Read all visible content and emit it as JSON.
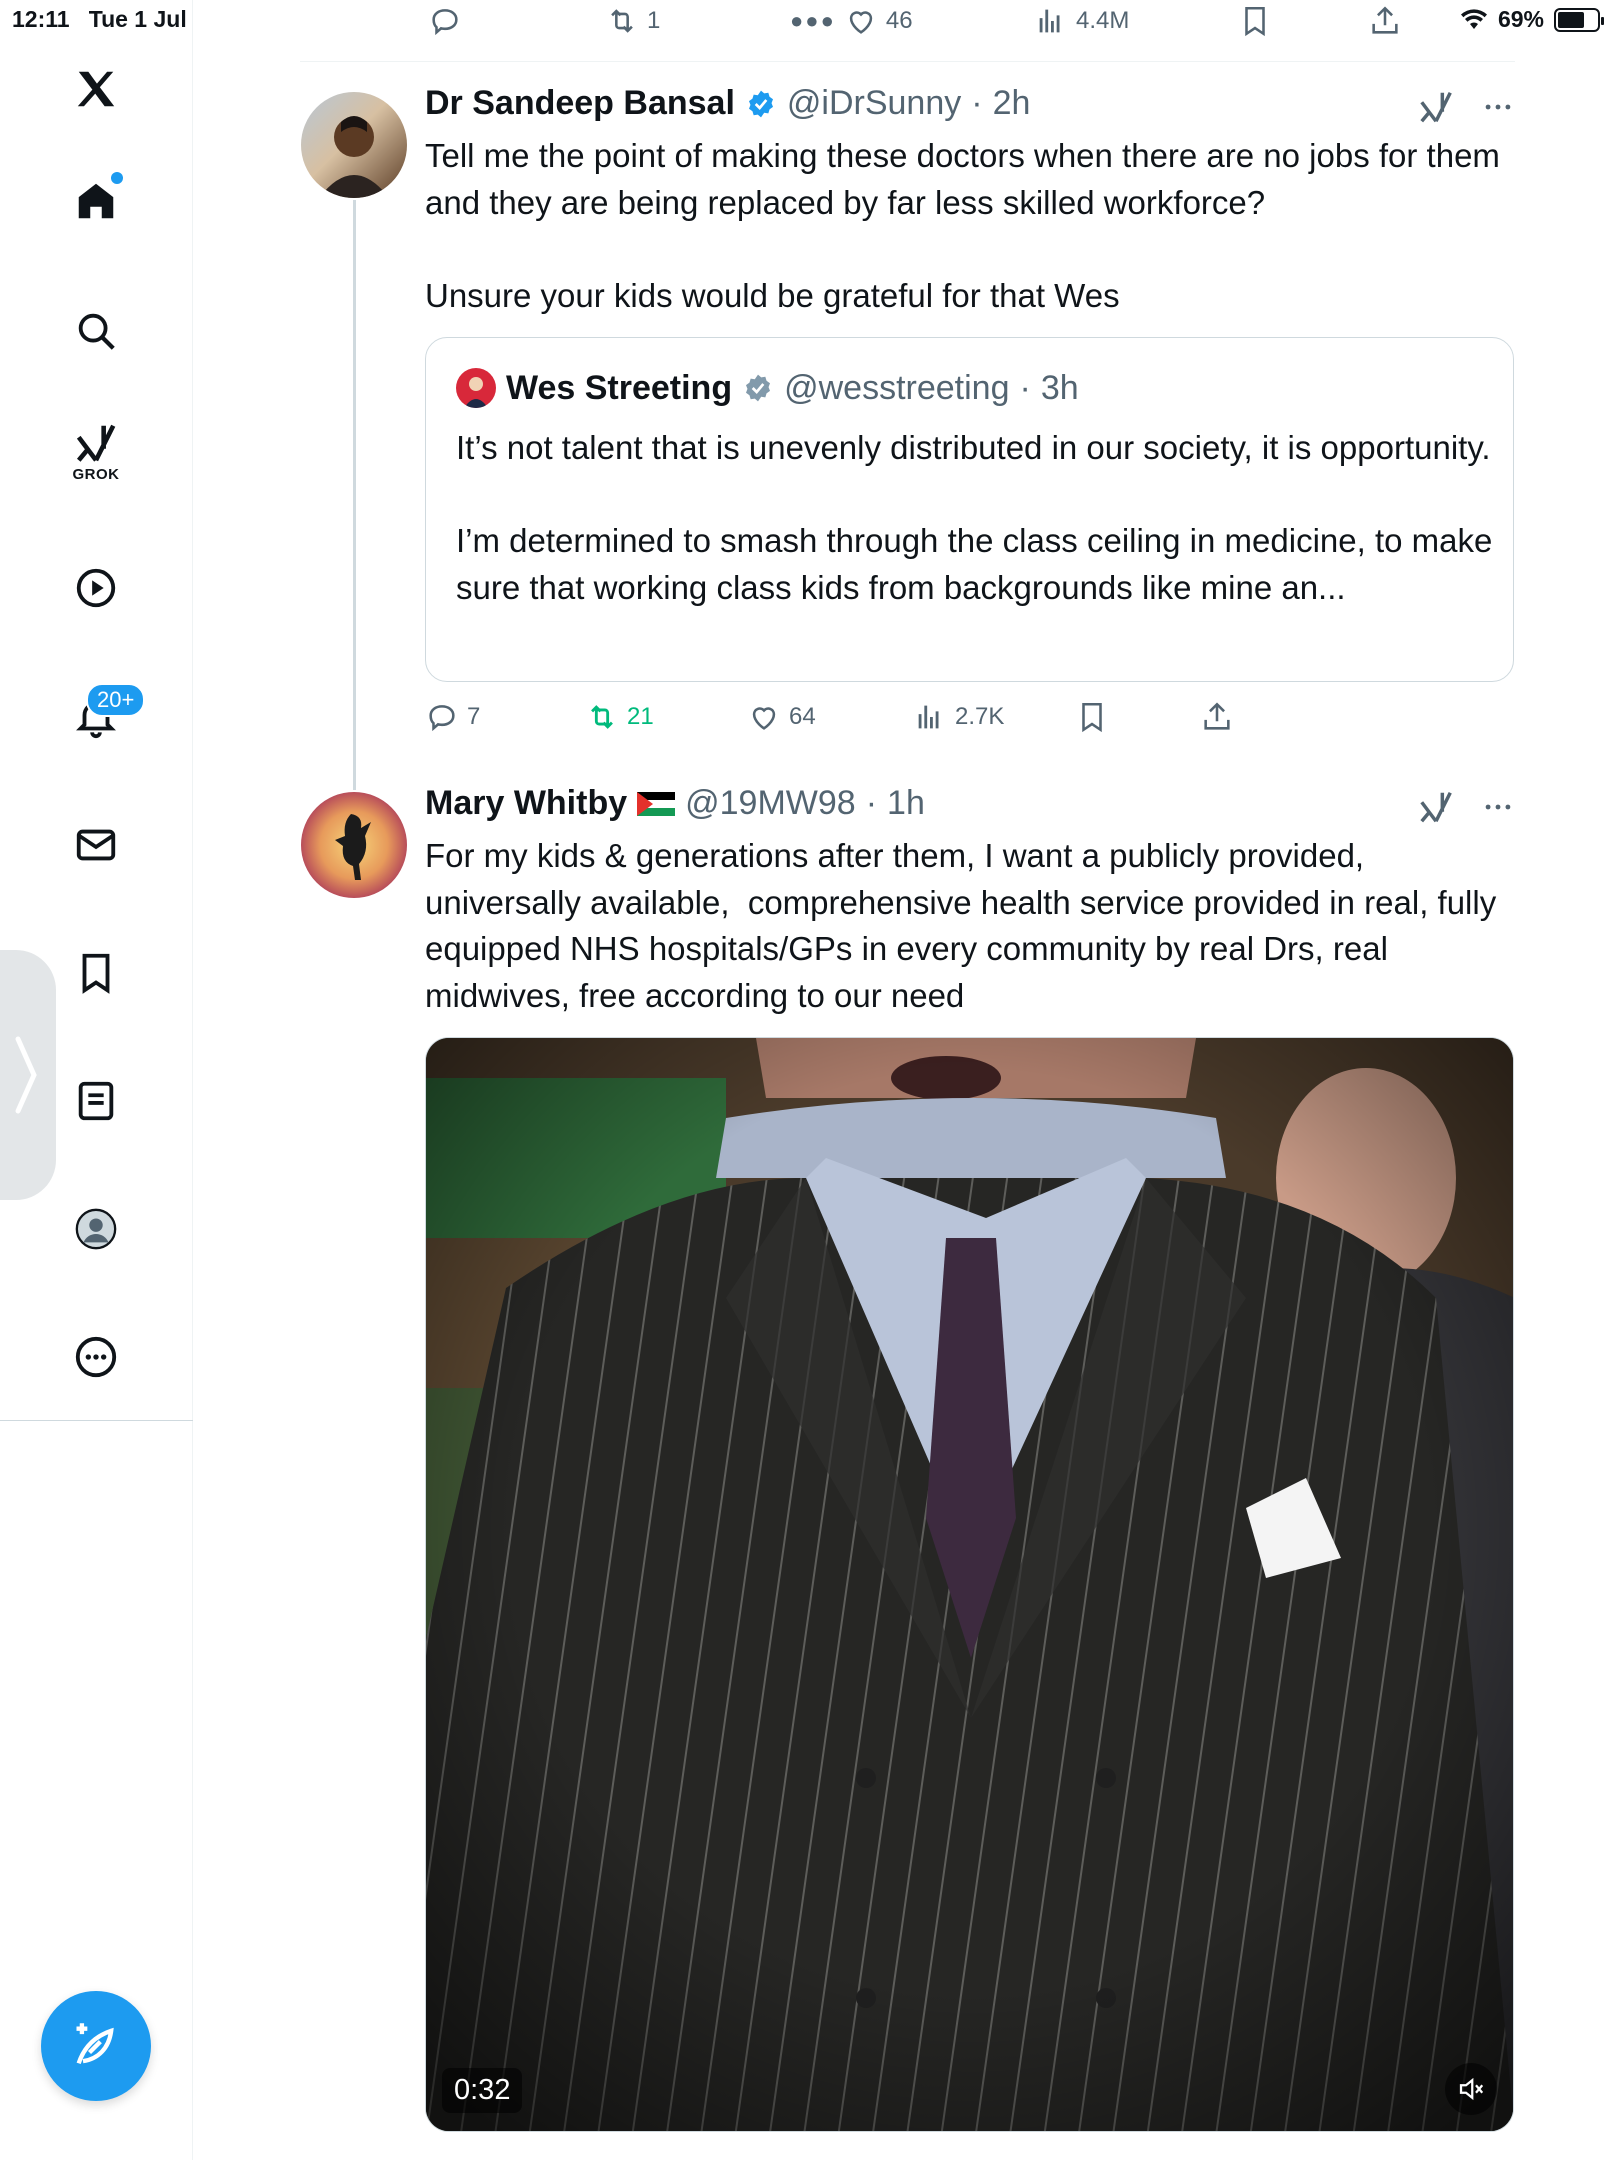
{
  "status_bar": {
    "time": "12:11",
    "date": "Tue 1 Jul",
    "battery": "69%",
    "battery_level": 0.69
  },
  "previous_tweet_actions": {
    "retweets": "1",
    "likes": "46",
    "views": "4.4M"
  },
  "sidebar": {
    "items": [
      {
        "icon": "x-logo-icon"
      },
      {
        "icon": "home-icon"
      },
      {
        "icon": "search-icon"
      },
      {
        "icon": "grok-icon",
        "label": "GROK"
      },
      {
        "icon": "video-icon"
      },
      {
        "icon": "notifications-icon",
        "badge": "20+"
      },
      {
        "icon": "messages-icon"
      },
      {
        "icon": "bookmarks-icon"
      },
      {
        "icon": "lists-icon"
      },
      {
        "icon": "profile-icon"
      },
      {
        "icon": "more-icon"
      }
    ],
    "compose_icon": "compose-icon"
  },
  "tweets": [
    {
      "name": "Dr Sandeep Bansal",
      "verified": true,
      "handle": "@iDrSunny",
      "separator": "·",
      "time": "2h",
      "text": "Tell me the point of making these doctors when there are no jobs for them and they are being replaced by far less skilled workforce?\n\nUnsure your kids would be grateful for that Wes",
      "quote": {
        "name": "Wes Streeting",
        "verified": true,
        "handle": "@wesstreeting",
        "separator": "·",
        "time": "3h",
        "text": "It’s not talent that is unevenly distributed in our society, it is opportunity.\n\nI’m determined to smash through the class ceiling in medicine, to make sure that working class kids from backgrounds like mine an..."
      },
      "actions": {
        "replies": "7",
        "retweets": "21",
        "likes": "64",
        "views": "2.7K"
      }
    },
    {
      "name": "Mary Whitby",
      "flag": "palestine-flag",
      "handle": "@19MW98",
      "separator": "·",
      "time": "1h",
      "text": "For my kids & generations after them, I want a publicly provided, universally available,  comprehensive health service provided in real, fully equipped NHS hospitals/GPs in every community by real Drs, real midwives, free according to our need",
      "media": {
        "type": "video",
        "duration": "0:32",
        "muted": true
      }
    }
  ],
  "colors": {
    "accent": "#1d9bf0",
    "retweet": "#00ba7c",
    "secondary_text": "#536471",
    "border": "#cfd9de"
  }
}
